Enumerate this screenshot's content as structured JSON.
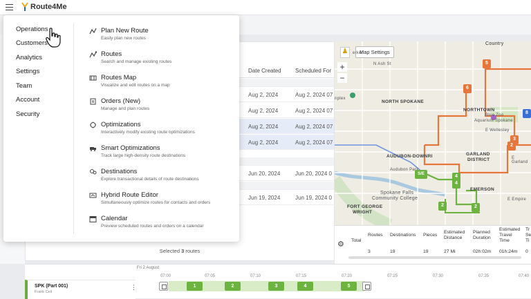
{
  "app": {
    "logo_text": "Route4Me"
  },
  "menu": {
    "left": [
      "Operations",
      "Customers",
      "Analytics",
      "Settings",
      "Team",
      "Account",
      "Security"
    ],
    "items": [
      {
        "title": "Plan New Route",
        "desc": "Easily plan new routes",
        "icon": "route-plan-icon"
      },
      {
        "title": "Routes",
        "desc": "Search and manage existing routes",
        "icon": "routes-icon"
      },
      {
        "title": "Routes Map",
        "desc": "Visualize and edit routes on a map",
        "icon": "map-icon"
      },
      {
        "title": "Orders (New)",
        "desc": "Manage and plan routes",
        "icon": "orders-icon"
      },
      {
        "title": "Optimizations",
        "desc": "Interactively modify existing route optimizations",
        "icon": "optimizations-icon"
      },
      {
        "title": "Smart Optimizations",
        "desc": "Track large high-density route destinations",
        "icon": "truck-icon"
      },
      {
        "title": "Destinations",
        "desc": "Explore transactional details of route destinations",
        "icon": "destinations-icon"
      },
      {
        "title": "Hybrid Route Editor",
        "desc": "Simultaneously optimize routes for contacts and orders",
        "icon": "hybrid-editor-icon"
      },
      {
        "title": "Calendar",
        "desc": "Preview scheduled routes and orders on a calendar",
        "icon": "calendar-icon"
      }
    ]
  },
  "table": {
    "headers": [
      "Date Created",
      "Scheduled For"
    ],
    "rows": [
      {
        "date": "Aug 2, 2024",
        "sched": "Aug 2, 2024 07"
      },
      {
        "date": "Aug 2, 2024",
        "sched": "Aug 2, 2024 07"
      },
      {
        "date": "Aug 2, 2024",
        "sched": "Aug 2, 2024 07"
      },
      {
        "date": "Aug 2, 2024",
        "sched": "Aug 2, 2024 07"
      },
      {
        "date": "Jun 20, 2024",
        "sched": "Jun 20, 2024 0"
      },
      {
        "date": "Jun 19, 2024",
        "sched": "Jun 19, 2024 0"
      }
    ],
    "selected_prefix": "Selected ",
    "selected_count": "3",
    "selected_suffix": " routes"
  },
  "map": {
    "settings_label": "Map Settings",
    "zoom_in": "+",
    "zoom_out": "−",
    "labels": {
      "country": "Country",
      "northtown": "NORTHTOWN",
      "north_spokane": "NORTH SPOKANE",
      "audubon": "AUDUBON-DOWNRI",
      "garland": "GARLAND",
      "district": "DISTRICT",
      "emerson": "EMERSON",
      "fort_george": "FORT GEORGE",
      "wright": "WRIGHT",
      "blue_zoo": "Blue Zoo",
      "aquarium": "Aquarium Spokane",
      "audubon_park": "Audubon Park",
      "spokane_falls": "Spokane Falls",
      "community_college": "Community College",
      "e_wellesley": "E Wellesley",
      "e_empire": "E Empire",
      "e_garland": "E Garland",
      "erkel": "erkel",
      "nplex": "nplex",
      "n_ash": "N Ash St"
    },
    "pins": [
      "5",
      "6",
      "3",
      "2",
      "4",
      "2",
      "S/E",
      "2",
      "4",
      "8"
    ]
  },
  "stats": {
    "headers": [
      "Total",
      "Routes",
      "Destinations",
      "Pieces",
      "Estimated Distance",
      "Planned Duration",
      "Estimated Travel Time",
      "Tr Se Ti"
    ],
    "values": [
      "3",
      "19",
      "19",
      "27 Mi",
      "02h:02m",
      "01h:24m",
      "0"
    ]
  },
  "timeline": {
    "date": "Fri 2 August",
    "ticks": [
      "07:00",
      "07:05",
      "07:10",
      "07:15",
      "07:20",
      "07:25",
      "07:30",
      "07:35",
      "07:40"
    ],
    "route_name": "SPK (Part 001)",
    "route_driver": "Frank Celi",
    "stops": [
      "1",
      "2",
      "3",
      "4",
      "5"
    ]
  },
  "colors": {
    "route_orange": "#e8763a",
    "route_green": "#6db33f",
    "accent_blue": "#3a6fd8"
  }
}
